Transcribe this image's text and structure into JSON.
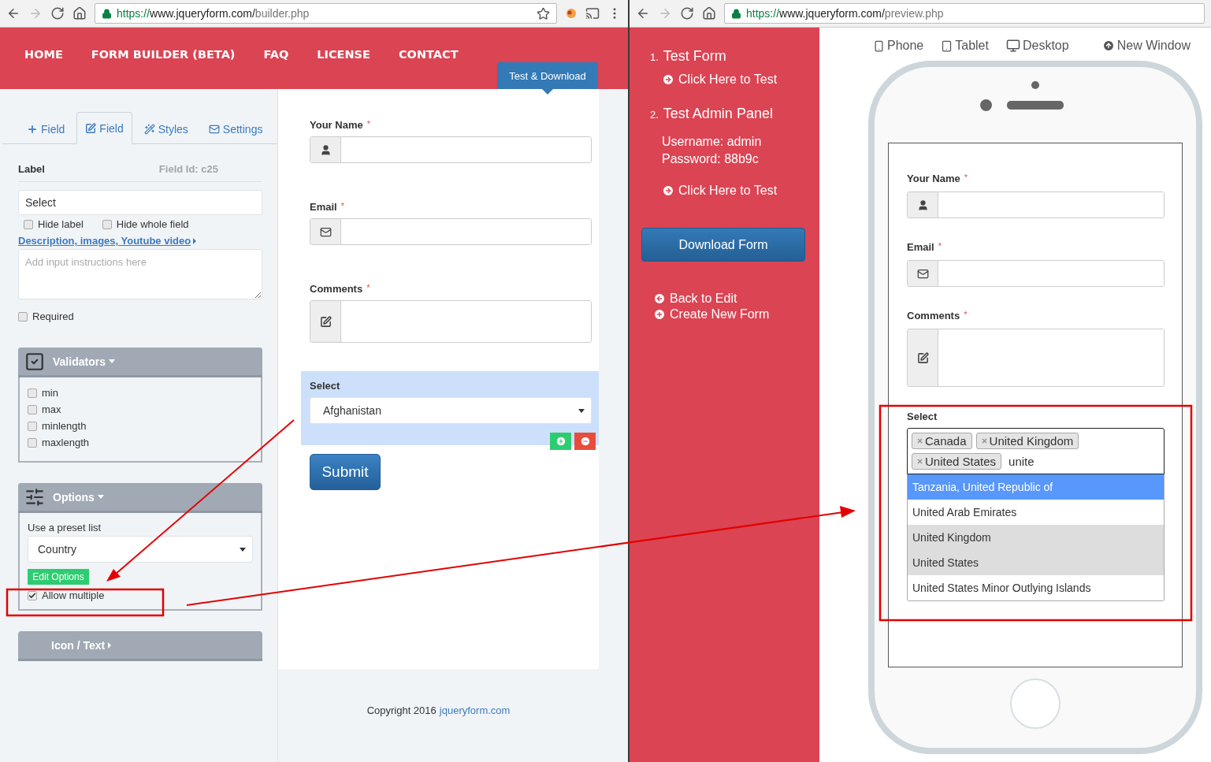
{
  "builder": {
    "url": {
      "scheme": "https://",
      "host": "www.jqueryform.com/",
      "path": "builder.php"
    },
    "nav": [
      "HOME",
      "FORM BUILDER (BETA)",
      "FAQ",
      "LICENSE",
      "CONTACT"
    ],
    "test_download": "Test & Download",
    "tabs": [
      {
        "label": "Field",
        "selected": false
      },
      {
        "label": "Field",
        "selected": true
      },
      {
        "label": "Styles",
        "selected": false
      },
      {
        "label": "Settings",
        "selected": false
      }
    ],
    "label_heading": "Label",
    "field_id": "Field Id: c25",
    "label_value": "Select",
    "hide_options": [
      {
        "label": "Hide label",
        "checked": false
      },
      {
        "label": "Hide whole field",
        "checked": false
      }
    ],
    "description_link": "Description, images, Youtube video",
    "instructions_placeholder": "Add input instructions here",
    "required": {
      "label": "Required",
      "checked": false
    },
    "validators": {
      "title": "Validators",
      "items": [
        {
          "label": "min",
          "checked": false
        },
        {
          "label": "max",
          "checked": false
        },
        {
          "label": "minlength",
          "checked": false
        },
        {
          "label": "maxlength",
          "checked": false
        }
      ]
    },
    "options": {
      "title": "Options",
      "preset_label": "Use a preset list",
      "preset_value": "Country",
      "edit_button": "Edit Options",
      "allow_multiple": {
        "label": "Allow multiple",
        "checked": true
      }
    },
    "icon_text": "Icon / Text",
    "form": {
      "fields": [
        {
          "label": "Your Name",
          "mark": "*",
          "kind": "text"
        },
        {
          "label": "Email",
          "mark": "*",
          "kind": "text"
        },
        {
          "label": "Comments",
          "mark": "*",
          "kind": "textarea"
        }
      ],
      "select": {
        "label": "Select",
        "value": "Afghanistan"
      },
      "submit": "Submit"
    },
    "copyright": {
      "text": "Copyright 2016",
      "link": "jqueryform.com"
    }
  },
  "preview": {
    "url": {
      "scheme": "https://",
      "host": "www.jqueryform.com/",
      "path": "preview.php"
    },
    "steps": [
      {
        "number": "1.",
        "title": "Test Form",
        "link": "Click Here to Test"
      },
      {
        "number": "2.",
        "title": "Test Admin Panel",
        "lines": [
          "Username: admin",
          "Password: 88b9c"
        ],
        "link": "Click Here to Test"
      }
    ],
    "download_button": "Download Form",
    "actions": [
      "Back to Edit",
      "Create New Form"
    ],
    "devices": [
      "Phone",
      "Tablet",
      "Desktop",
      "New Window"
    ],
    "form": {
      "fields": [
        {
          "label": "Your Name",
          "mark": "*",
          "kind": "text"
        },
        {
          "label": "Email",
          "mark": "*",
          "kind": "text"
        },
        {
          "label": "Comments",
          "mark": "*",
          "kind": "textarea"
        }
      ],
      "select": {
        "label": "Select",
        "tags": [
          "Canada",
          "United Kingdom",
          "United States"
        ],
        "query": "unite",
        "results": [
          {
            "label": "Tanzania, United Republic of",
            "highlighted": true,
            "selected": false
          },
          {
            "label": "United Arab Emirates",
            "highlighted": false,
            "selected": false
          },
          {
            "label": "United Kingdom",
            "highlighted": false,
            "selected": true
          },
          {
            "label": "United States",
            "highlighted": false,
            "selected": true
          },
          {
            "label": "United States Minor Outlying Islands",
            "highlighted": false,
            "selected": false
          }
        ]
      }
    }
  }
}
